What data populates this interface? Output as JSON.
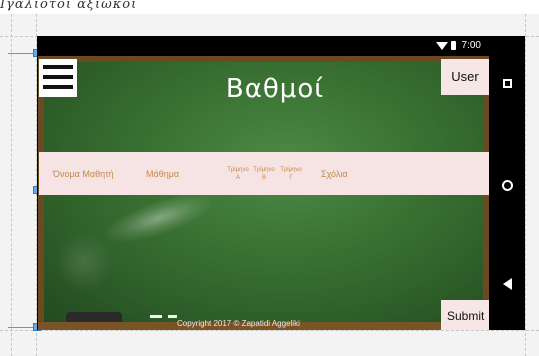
{
  "header_caption": "Ιγάλιοτοι αξιωκοι",
  "status_bar": {
    "time": "7:00"
  },
  "app": {
    "title": "Βαθμοί",
    "user_button": "User",
    "submit_button": "Submit",
    "footer": "Copyright 2017 ©    Zapatidi Aggeliki"
  },
  "table_header": {
    "student_name": "Όνομα Μαθητή",
    "course": "Μάθημα",
    "term_a": "Τρίμηνο Α",
    "term_b": "Τρίμηνο Β",
    "term_c": "Τρίμηνο Γ",
    "comments": "Σχόλια"
  },
  "nav_bar": {
    "icons": [
      "square-recent-icon",
      "circle-home-icon",
      "triangle-back-icon"
    ]
  },
  "colors": {
    "chalkboard": "#3c7535",
    "frame": "#6b4a22",
    "header_row": "#f6e4e4",
    "header_text": "#c4894a",
    "selection_blue": "#4f9bdc"
  }
}
